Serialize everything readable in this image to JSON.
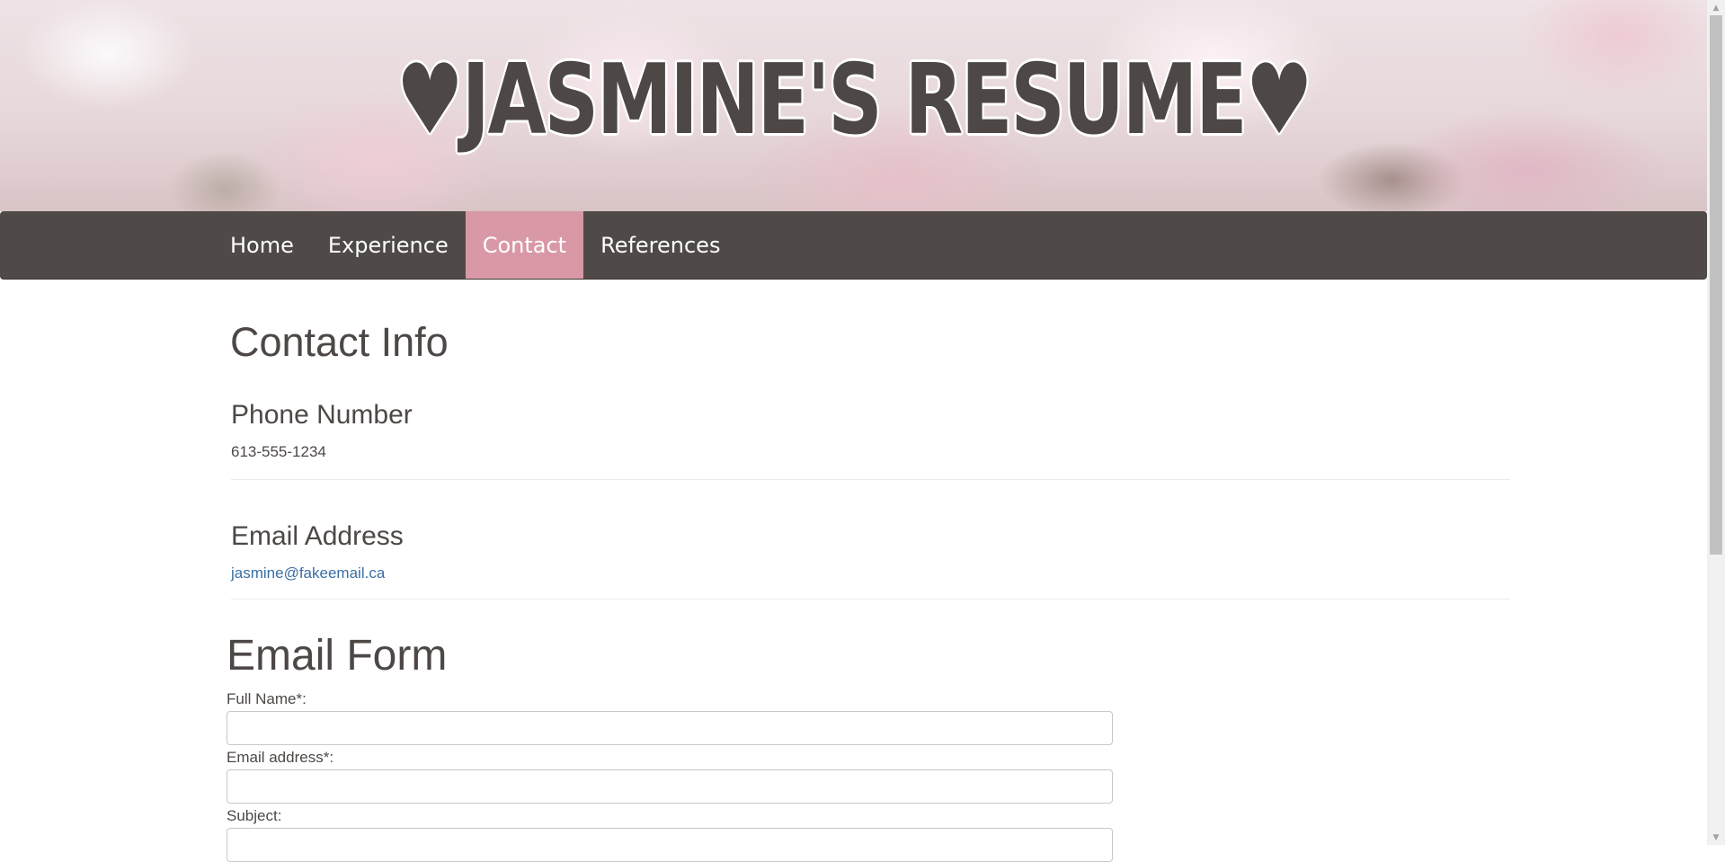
{
  "banner": {
    "title": "♥Jasmine's Resume♥"
  },
  "nav": {
    "items": [
      {
        "label": "Home"
      },
      {
        "label": "Experience"
      },
      {
        "label": "Contact"
      },
      {
        "label": "References"
      }
    ],
    "active": "Contact"
  },
  "contact": {
    "heading": "Contact Info",
    "phone": {
      "heading": "Phone Number",
      "value": "613-555-1234"
    },
    "email": {
      "heading": "Email Address",
      "value": "jasmine@fakeemail.ca"
    }
  },
  "form": {
    "heading": "Email Form",
    "full_name_label": "Full Name*:",
    "email_label": "Email address*:",
    "subject_label": "Subject:"
  },
  "colors": {
    "navbar": "#4f4a48",
    "nav_active": "#d998a6",
    "text": "#4d4846",
    "link": "#3b6ea5"
  }
}
